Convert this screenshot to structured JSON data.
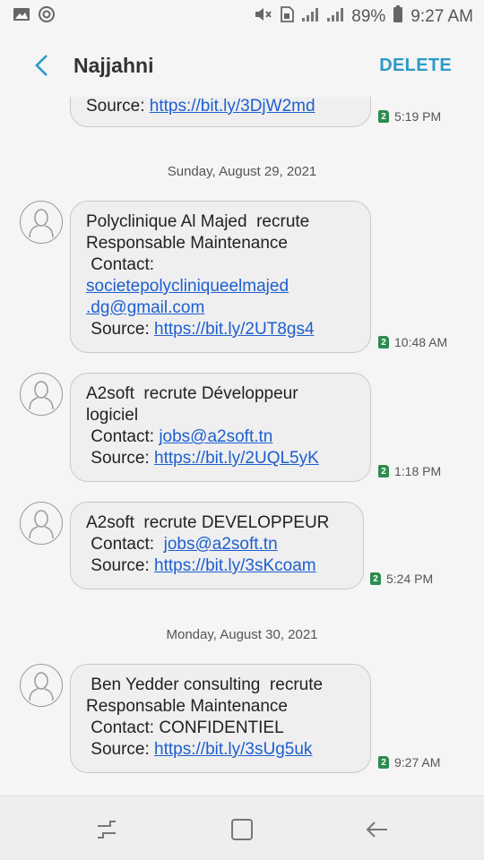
{
  "status_bar": {
    "battery": "89%",
    "time": "9:27 AM",
    "left_icons": [
      "image-icon",
      "sync-icon"
    ],
    "right_icons": [
      "mute-icon",
      "sim-icon",
      "signal-icon",
      "signal-icon"
    ]
  },
  "app_bar": {
    "back_icon": "back-arrow-icon",
    "title": "Najjahni",
    "delete_label": "DELETE",
    "accent_color": "#2a9ac8"
  },
  "thread": {
    "partial_message": {
      "source_label": "Source: ",
      "link": "https://bit.ly/3DjW2md",
      "sim": "2",
      "time": "5:19 PM"
    },
    "date_1": "Sunday, August 29, 2021",
    "date_2": "Monday, August 30, 2021",
    "messages": [
      {
        "line1": "Polyclinique Al Majed  recrute",
        "line2": "Responsable Maintenance",
        "contact_label": " Contact:",
        "contact_link_1": "societepolycliniqueelmajed",
        "contact_link_2": ".dg@gmail.com",
        "source_label": " Source: ",
        "source_link": "https://bit.ly/2UT8gs4",
        "sim": "2",
        "time": "10:48 AM"
      },
      {
        "line1": "A2soft  recrute Développeur",
        "line2": "logiciel",
        "contact_label": " Contact: ",
        "contact_link": "jobs@a2soft.tn",
        "source_label": " Source: ",
        "source_link": "https://bit.ly/2UQL5yK",
        "sim": "2",
        "time": "1:18 PM"
      },
      {
        "line1": "A2soft  recrute DEVELOPPEUR",
        "contact_label": " Contact:  ",
        "contact_link": "jobs@a2soft.tn",
        "source_label": " Source: ",
        "source_link": "https://bit.ly/3sKcoam",
        "sim": "2",
        "time": "5:24 PM"
      },
      {
        "line1": " Ben Yedder consulting  recrute",
        "line2": "Responsable Maintenance",
        "line3": " Contact: CONFIDENTIEL",
        "source_label": " Source: ",
        "source_link": "https://bit.ly/3sUg5uk",
        "sim": "2",
        "time": "9:27 AM"
      }
    ]
  },
  "nav_bar": {
    "icons": [
      "recents-icon",
      "home-icon",
      "back-icon"
    ]
  }
}
